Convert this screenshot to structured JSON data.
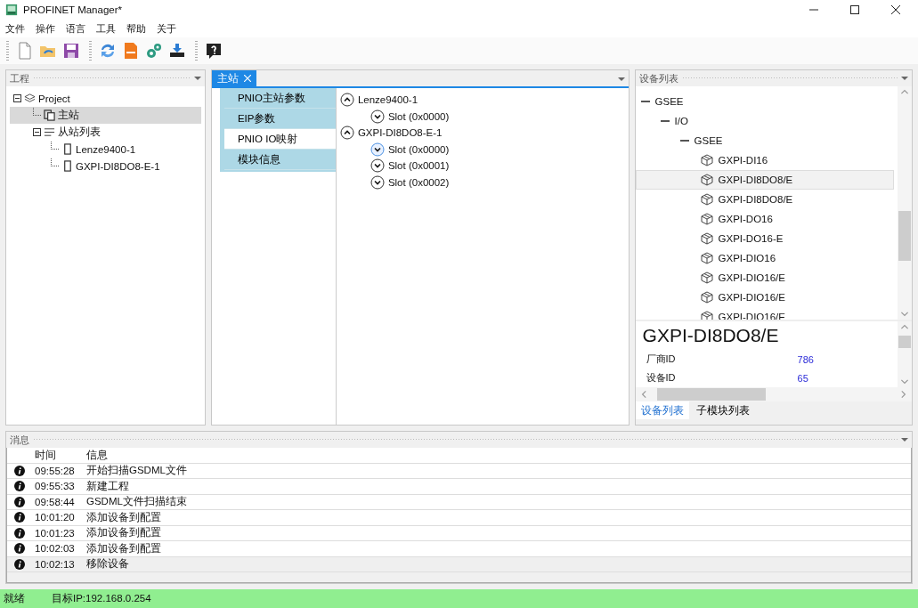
{
  "window": {
    "title": "PROFINET Manager*"
  },
  "menu": [
    {
      "label": "文件"
    },
    {
      "label": "操作"
    },
    {
      "label": "语言"
    },
    {
      "label": "工具"
    },
    {
      "label": "帮助"
    },
    {
      "label": "关于"
    }
  ],
  "project_panel": {
    "title": "工程",
    "tree": [
      {
        "label": "Project",
        "kind": "project",
        "expanded": true,
        "selected": false,
        "children": [
          {
            "label": "主站",
            "kind": "master",
            "selected": true
          },
          {
            "label": "从站列表",
            "kind": "list",
            "expanded": true,
            "selected": false,
            "children": [
              {
                "label": "Lenze9400-1",
                "kind": "device",
                "selected": false
              },
              {
                "label": "GXPI-DI8DO8-E-1",
                "kind": "device",
                "selected": false
              }
            ]
          }
        ]
      }
    ]
  },
  "editor": {
    "tab": {
      "label": "主站"
    },
    "side_tabs": [
      {
        "label": "PNIO主站参数",
        "selected": false
      },
      {
        "label": "EIP参数",
        "selected": false
      },
      {
        "label": "PNIO IO映射",
        "selected": true
      },
      {
        "label": "模块信息",
        "selected": false
      }
    ],
    "io_tree": [
      {
        "label": "Lenze9400-1",
        "expanded": true,
        "children": [
          {
            "label": "Slot (0x0000)",
            "expanded": false,
            "focused": false
          }
        ]
      },
      {
        "label": "GXPI-DI8DO8-E-1",
        "expanded": true,
        "children": [
          {
            "label": "Slot (0x0000)",
            "expanded": false,
            "focused": true
          },
          {
            "label": "Slot (0x0001)",
            "expanded": false,
            "focused": false
          },
          {
            "label": "Slot (0x0002)",
            "expanded": false,
            "focused": false
          }
        ]
      }
    ]
  },
  "device_panel": {
    "title": "设备列表",
    "tree": [
      {
        "label": "GSEE",
        "expanded": true,
        "children": [
          {
            "label": "I/O",
            "expanded": true,
            "children": [
              {
                "label": "GSEE",
                "expanded": true,
                "children": [
                  {
                    "label": "GXPI-DI16",
                    "selected": false
                  },
                  {
                    "label": "GXPI-DI8DO8/E",
                    "selected": true
                  },
                  {
                    "label": "GXPI-DI8DO8/E",
                    "selected": false
                  },
                  {
                    "label": "GXPI-DO16",
                    "selected": false
                  },
                  {
                    "label": "GXPI-DO16-E",
                    "selected": false
                  },
                  {
                    "label": "GXPI-DIO16",
                    "selected": false
                  },
                  {
                    "label": "GXPI-DIO16/E",
                    "selected": false
                  },
                  {
                    "label": "GXPI-DIO16/E",
                    "selected": false
                  },
                  {
                    "label": "GXPI-DIO16/E",
                    "selected": false
                  }
                ]
              }
            ]
          }
        ]
      }
    ],
    "detail": {
      "name": "GXPI-DI8DO8/E",
      "props": [
        {
          "label": "厂商ID",
          "value": "786"
        },
        {
          "label": "设备ID",
          "value": "65"
        }
      ]
    },
    "tabs": [
      {
        "label": "设备列表",
        "selected": true
      },
      {
        "label": "子模块列表",
        "selected": false
      }
    ]
  },
  "messages": {
    "title": "消息",
    "columns": [
      "时间",
      "信息"
    ],
    "rows": [
      {
        "time": "09:55:28",
        "text": "开始扫描GSDML文件",
        "selected": false
      },
      {
        "time": "09:55:33",
        "text": "新建工程",
        "selected": false
      },
      {
        "time": "09:58:44",
        "text": "GSDML文件扫描结束",
        "selected": false
      },
      {
        "time": "10:01:20",
        "text": "添加设备到配置",
        "selected": false
      },
      {
        "time": "10:01:23",
        "text": "添加设备到配置",
        "selected": false
      },
      {
        "time": "10:02:03",
        "text": "添加设备到配置",
        "selected": false
      },
      {
        "time": "10:02:13",
        "text": "移除设备",
        "selected": true
      }
    ]
  },
  "status_bar": [
    {
      "text": "就绪"
    },
    {
      "text": "目标IP:192.168.0.254"
    }
  ]
}
